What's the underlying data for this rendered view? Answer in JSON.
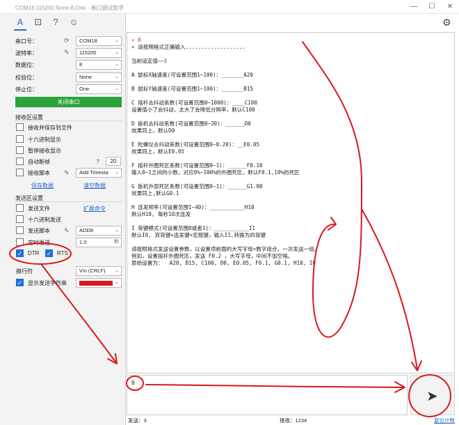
{
  "window": {
    "title": "COM18,115200,None,8,One - 串口调试助手",
    "minimize": "—",
    "maximize": "☐",
    "close": "✕"
  },
  "toolbar": {
    "icons": [
      "font-icon",
      "chart-icon",
      "help-icon",
      "emoji-icon"
    ]
  },
  "port_settings": {
    "port_label": "串口号：",
    "port_value": "COM18",
    "baud_label": "波特率：",
    "baud_value": "115200",
    "databits_label": "数据位：",
    "databits_value": "8",
    "parity_label": "校验位：",
    "parity_value": "None",
    "stopbits_label": "停止位：",
    "stopbits_value": "One",
    "open_button": "关闭串口"
  },
  "receive": {
    "title": "接收区设置",
    "save_to_file": "接收并保存到文件",
    "hex_display": "十六进制显示",
    "pause_display": "暂停接收显示",
    "auto_break": "自动断帧",
    "auto_break_value": "20",
    "recv_script": "接收脚本",
    "recv_script_value": "Add Timesta",
    "save_data": "保存数据",
    "clear_data": "清空数据"
  },
  "send": {
    "title": "发送区设置",
    "send_file": "发送文件",
    "expand_cmd": "扩展命令",
    "hex_send": "十六进制发送",
    "send_script": "发送脚本",
    "send_script_value": "ADD8",
    "timed_send": "定时发送",
    "timed_value": "1.0",
    "timed_unit": "秒",
    "dtr": "DTR",
    "rts": "RTS"
  },
  "newline": {
    "label": "换行符",
    "value": "\\r\\n (CRLF)",
    "show_color": "显示发送字符串"
  },
  "terminal": {
    "lines": [
      "» 0",
      "« 请按照格式正确输入...................",
      "",
      "当前设定值——》",
      "",
      "A 鼠标X轴速度(可设置范围1~100)：_______A20",
      "",
      "B 鼠标Y轴速度(可设置范围1~100)：_______B15",
      "",
      "C 摇杆去抖动系数(可设置范围0~1000)：____C100",
      "设置值小了会抖动，太大了会降低分辨率，默认C100",
      "",
      "D 扳机去抖动系数(可设置范围0~30)：______D0",
      "效果同上，默认D0",
      "",
      "E 陀螺仪去抖动系数(可设置范围0~0.20)：__E0.05",
      "效果同上，默认E0.05",
      "",
      "F 摇杆外圈死区系数(可设置范围0~1)：______F0.10",
      "输入0~1之间的小数，对应0%~100%的外圈死区，默认F0.1,10%的死区",
      "",
      "G 扳机外部死区系数(可设置范围0~1)：______G1.00",
      "效果同上,默认G0.1",
      "",
      "H 连发频率(可设置范围1~40)：___________H10",
      "默认H10, 每秒10次连发",
      "",
      "I 背键模式(可设置范围0或者1)：___________I1",
      "默认I0, 双背键+连发键+宏按键，输入I1,转换为四背键",
      "",
      "请按照格式发送设置参数，以设置项前面的大写字母+数字组合，一次发送一组。",
      "例如，设置摇杆外圈死区，发送 F0.2 ，大写字母，中间不加空格。",
      "原始设置为：  A20, B15, C100, D0, E0.05, F0.1, G0.1, H10, I0"
    ]
  },
  "input": {
    "value": "0"
  },
  "status": {
    "sent": "发送：3",
    "received": "接收：1234",
    "reset": "复位计数"
  },
  "colors": {
    "accent": "#2b6cc4",
    "open_button": "#2aa33b",
    "annotation": "#d8181b"
  }
}
